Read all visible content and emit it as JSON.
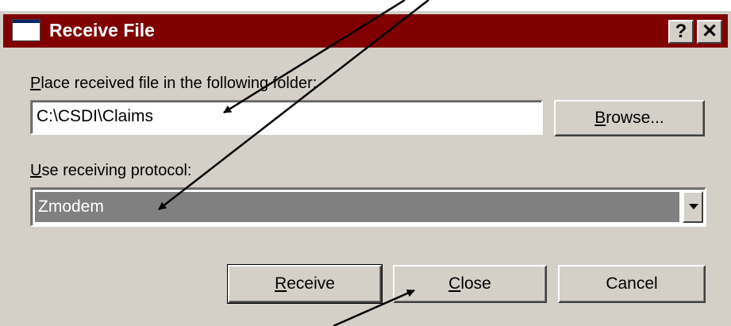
{
  "window": {
    "title": "Receive File",
    "help_label": "?",
    "close_label": "✕",
    "colors": {
      "titlebar": "#800000",
      "face": "#d4d0c8"
    }
  },
  "folder": {
    "label_mnemonic": "P",
    "label_rest": "lace received file in the following folder:",
    "value": "C:\\CSDI\\Claims",
    "browse_mnemonic": "B",
    "browse_rest": "rowse..."
  },
  "protocol": {
    "label_mnemonic": "U",
    "label_rest": "se receiving protocol:",
    "selected": "Zmodem"
  },
  "buttons": {
    "receive_mnemonic": "R",
    "receive_rest": "eceive",
    "close_mnemonic": "C",
    "close_rest": "lose",
    "cancel": "Cancel"
  },
  "annotation_arrows": {
    "count": 4,
    "color": "#000000"
  }
}
